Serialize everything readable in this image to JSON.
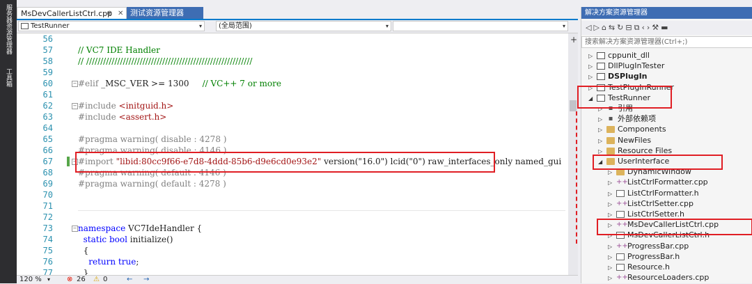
{
  "left_strip": {
    "tabs": [
      "服务器资源管理器",
      "工具箱"
    ]
  },
  "tabs": [
    {
      "label": "MsDevCallerListCtrl.cpp",
      "pin": "⊕",
      "close": "✕"
    },
    {
      "label": "测试资源管理器"
    }
  ],
  "nav": {
    "project": "TestRunner",
    "scope": "(全局范围)"
  },
  "editor": {
    "lines": [
      {
        "n": "56",
        "parts": []
      },
      {
        "n": "57",
        "parts": [
          {
            "c": "cm",
            "t": "// VC7 IDE Handler"
          }
        ]
      },
      {
        "n": "58",
        "parts": [
          {
            "c": "cm",
            "t": "// ///////////////////////////////////////////////////////////"
          }
        ]
      },
      {
        "n": "59",
        "parts": []
      },
      {
        "n": "60",
        "parts": [
          {
            "c": "pp",
            "t": "#elif "
          },
          {
            "c": "pl",
            "t": "_MSC_VER >= 1300"
          },
          {
            "c": "cm",
            "t": "     // VC++ 7 or more"
          }
        ]
      },
      {
        "n": "61",
        "parts": []
      },
      {
        "n": "62",
        "parts": [
          {
            "c": "pp",
            "t": "#include "
          },
          {
            "c": "st",
            "t": "<initguid.h>"
          }
        ]
      },
      {
        "n": "63",
        "parts": [
          {
            "c": "pp",
            "t": "#include "
          },
          {
            "c": "st",
            "t": "<assert.h>"
          }
        ]
      },
      {
        "n": "64",
        "parts": []
      },
      {
        "n": "65",
        "parts": [
          {
            "c": "pp",
            "t": "#pragma warning( disable : 4278 )"
          }
        ]
      },
      {
        "n": "66",
        "parts": [
          {
            "c": "pp",
            "t": "#pragma warning( disable : 4146 )"
          }
        ]
      },
      {
        "n": "67",
        "parts": [
          {
            "c": "pp",
            "t": "#import "
          },
          {
            "c": "st",
            "t": "\"libid:80cc9f66-e7d8-4ddd-85b6-d9e6cd0e93e2\""
          },
          {
            "c": "pl",
            "t": " version(\"16.0\") lcid(\"0\") raw_interfaces_only named_gui"
          }
        ]
      },
      {
        "n": "68",
        "parts": [
          {
            "c": "pp",
            "t": "#pragma warning( default : 4146 )"
          }
        ]
      },
      {
        "n": "69",
        "parts": [
          {
            "c": "pp",
            "t": "#pragma warning( default : 4278 )"
          }
        ]
      },
      {
        "n": "70",
        "parts": []
      },
      {
        "n": "71",
        "parts": []
      },
      {
        "n": "72",
        "parts": []
      },
      {
        "n": "73",
        "parts": [
          {
            "c": "kw",
            "t": "namespace"
          },
          {
            "c": "pl",
            "t": " VC7IdeHandler {"
          }
        ]
      },
      {
        "n": "74",
        "parts": [
          {
            "c": "pl",
            "t": "  "
          },
          {
            "c": "kw",
            "t": "static bool"
          },
          {
            "c": "pl",
            "t": " initialize()"
          }
        ]
      },
      {
        "n": "75",
        "parts": [
          {
            "c": "pl",
            "t": "  {"
          }
        ]
      },
      {
        "n": "76",
        "parts": [
          {
            "c": "pl",
            "t": "    "
          },
          {
            "c": "kw",
            "t": "return true"
          },
          {
            "c": "pl",
            "t": ";"
          }
        ]
      },
      {
        "n": "77",
        "parts": [
          {
            "c": "pl",
            "t": "  }"
          }
        ]
      }
    ]
  },
  "status": {
    "zoom": "120 %",
    "errors": "26",
    "warnings": "0"
  },
  "solution_explorer": {
    "title": "解决方案资源管理器",
    "search_placeholder": "搜索解决方案资源管理器(Ctrl+;)",
    "items": [
      {
        "label": "cppunit_dll",
        "indent": 0,
        "expander": "▷",
        "icon": "proj",
        "bold": false
      },
      {
        "label": "DllPlugInTester",
        "indent": 0,
        "expander": "▷",
        "icon": "proj",
        "bold": false
      },
      {
        "label": "DSPlugIn",
        "indent": 0,
        "expander": "▷",
        "icon": "proj",
        "bold": true
      },
      {
        "label": "TestPlugInRunner",
        "indent": 0,
        "expander": "▷",
        "icon": "proj",
        "bold": false
      },
      {
        "label": "TestRunner",
        "indent": 0,
        "expander": "◢",
        "icon": "proj",
        "bold": false
      },
      {
        "label": "引用",
        "indent": 1,
        "expander": "▷",
        "icon": "ref",
        "bold": false
      },
      {
        "label": "外部依赖项",
        "indent": 1,
        "expander": "▷",
        "icon": "ref",
        "bold": false
      },
      {
        "label": "Components",
        "indent": 1,
        "expander": "▷",
        "icon": "folder",
        "bold": false
      },
      {
        "label": "NewFiles",
        "indent": 1,
        "expander": "▷",
        "icon": "folder",
        "bold": false
      },
      {
        "label": "Resource Files",
        "indent": 1,
        "expander": "▷",
        "icon": "folder",
        "bold": false
      },
      {
        "label": "UserInterface",
        "indent": 1,
        "expander": "◢",
        "icon": "folder",
        "bold": false
      },
      {
        "label": "DynamicWindow",
        "indent": 2,
        "expander": "▷",
        "icon": "folder",
        "bold": false
      },
      {
        "label": "ListCtrlFormatter.cpp",
        "indent": 2,
        "expander": "▷",
        "icon": "cpp",
        "bold": false
      },
      {
        "label": "ListCtrlFormatter.h",
        "indent": 2,
        "expander": "▷",
        "icon": "h",
        "bold": false
      },
      {
        "label": "ListCtrlSetter.cpp",
        "indent": 2,
        "expander": "▷",
        "icon": "cpp",
        "bold": false
      },
      {
        "label": "ListCtrlSetter.h",
        "indent": 2,
        "expander": "▷",
        "icon": "h",
        "bold": false
      },
      {
        "label": "MsDevCallerListCtrl.cpp",
        "indent": 2,
        "expander": "▷",
        "icon": "cpp",
        "bold": false
      },
      {
        "label": "MsDevCallerListCtrl.h",
        "indent": 2,
        "expander": "▷",
        "icon": "h",
        "bold": false
      },
      {
        "label": "ProgressBar.cpp",
        "indent": 2,
        "expander": "▷",
        "icon": "cpp",
        "bold": false
      },
      {
        "label": "ProgressBar.h",
        "indent": 2,
        "expander": "▷",
        "icon": "h",
        "bold": false
      },
      {
        "label": "Resource.h",
        "indent": 2,
        "expander": "▷",
        "icon": "h",
        "bold": false
      },
      {
        "label": "ResourceLoaders.cpp",
        "indent": 2,
        "expander": "▷",
        "icon": "cpp",
        "bold": false
      }
    ]
  }
}
